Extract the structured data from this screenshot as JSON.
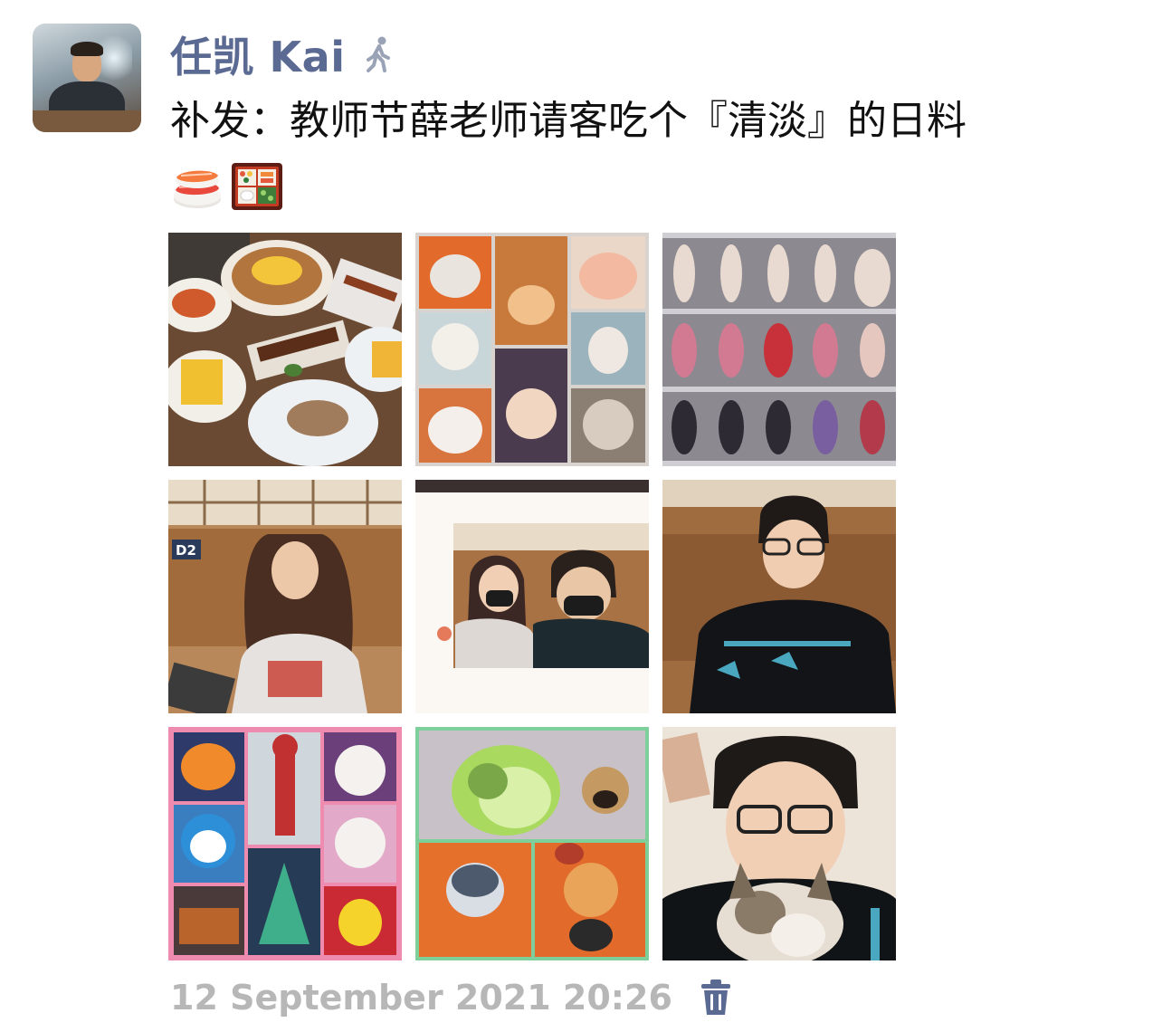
{
  "post": {
    "author": "任凯 Kai",
    "text": "补发：教师节薛老师请客吃个『清淡』的日料",
    "emojis": [
      "sushi-emoji",
      "bento-box-emoji"
    ],
    "timestamp": "12 September 2021 20:26"
  },
  "photos": [
    {
      "label": "japanese-dishes-photo"
    },
    {
      "label": "cat-figurines-collage-photo"
    },
    {
      "label": "dolls-display-photo"
    },
    {
      "label": "girl-at-table-photo"
    },
    {
      "label": "couple-selfie-framed-photo"
    },
    {
      "label": "boy-at-table-photo"
    },
    {
      "label": "toy-figures-collage-photo"
    },
    {
      "label": "cabbage-dog-figurines-photo"
    },
    {
      "label": "boy-with-cat-selfie-photo"
    }
  ],
  "colors": {
    "name": "#5b6a92",
    "timestamp": "#b7b7b7",
    "trash": "#5b6a92",
    "text": "#111111"
  },
  "icons": {
    "author_status": "walking-person-icon",
    "delete": "trash-icon"
  }
}
